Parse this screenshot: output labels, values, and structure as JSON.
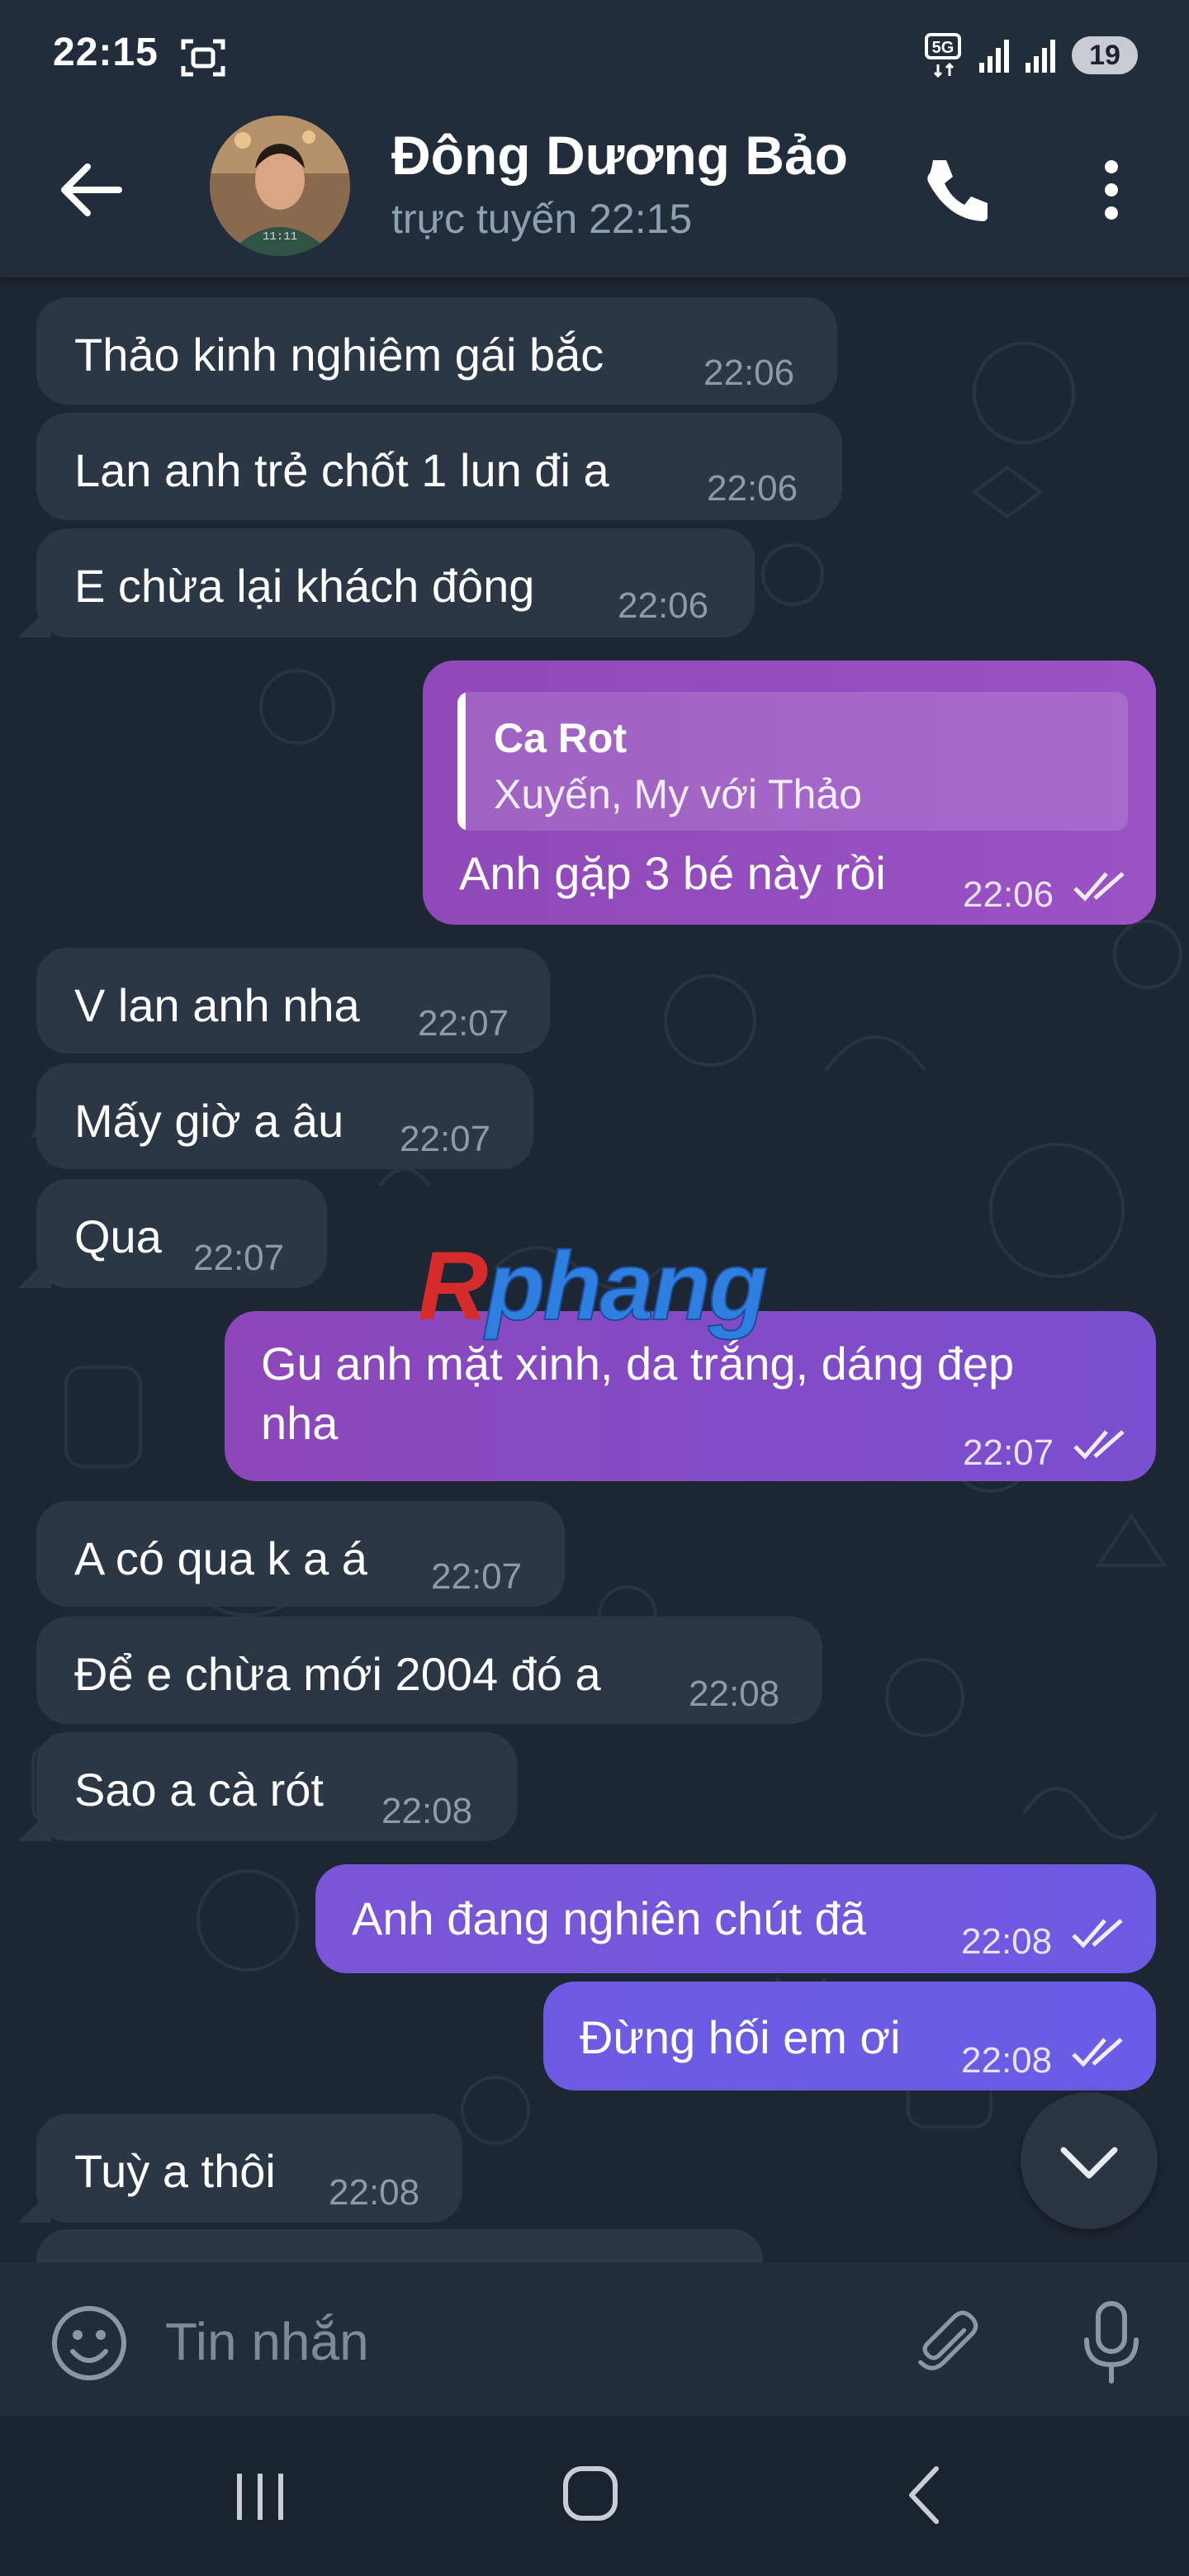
{
  "status_bar": {
    "time": "22:15",
    "battery": "19",
    "network": "5G",
    "icons": [
      "screenshot-icon",
      "5g-icon",
      "signal-icon",
      "signal-icon-2",
      "battery-icon"
    ]
  },
  "header": {
    "contact_name": "Đông Dương Bảo",
    "status": "trực tuyến 22:15",
    "icons": [
      "back-arrow-icon",
      "avatar",
      "phone-icon",
      "more-vertical-icon"
    ]
  },
  "messages": [
    {
      "dir": "in",
      "text": "Thảo kinh nghiêm gái bắc",
      "time": "22:06"
    },
    {
      "dir": "in",
      "text": "Lan anh trẻ chốt 1 lun đi a",
      "time": "22:06"
    },
    {
      "dir": "in",
      "text": "E chừa lại khách đông",
      "time": "22:06"
    },
    {
      "dir": "out",
      "reply_to": {
        "name": "Ca Rot",
        "text": "Xuyến, My với Thảo"
      },
      "text": "Anh gặp 3 bé này rồi",
      "time": "22:06",
      "read": true
    },
    {
      "dir": "in",
      "text": "V lan anh nha",
      "time": "22:07"
    },
    {
      "dir": "in",
      "text": "Mấy giờ a âu",
      "time": "22:07"
    },
    {
      "dir": "in",
      "text": "Qua",
      "time": "22:07"
    },
    {
      "dir": "out",
      "text_line1": "Gu anh mặt xinh, da trắng, dáng đẹp",
      "text_line2": "nha",
      "time": "22:07",
      "read": true
    },
    {
      "dir": "in",
      "text": "A có qua k a á",
      "time": "22:07"
    },
    {
      "dir": "in",
      "text": "Để e chừa mới 2004 đó a",
      "time": "22:08"
    },
    {
      "dir": "in",
      "text": "Sao a cà rót",
      "time": "22:08"
    },
    {
      "dir": "out",
      "text": "Anh đang nghiên chút đã",
      "time": "22:08",
      "read": true
    },
    {
      "dir": "out",
      "text": "Đừng hối em ơi",
      "time": "22:08",
      "read": true
    },
    {
      "dir": "in",
      "text": "Tuỳ a thôi",
      "time": "22:08"
    }
  ],
  "watermark": {
    "first": "R",
    "rest": "phang"
  },
  "input": {
    "placeholder": "Tin nhắn"
  },
  "colors": {
    "header_bg": "#212d3b",
    "chat_bg": "#1d2733",
    "incoming_bubble": "#2b3744",
    "outgoing_gradient": [
      "#9d4fbf",
      "#6b5ce8"
    ],
    "secondary_text": "#8d9aa8"
  },
  "navigation": {
    "icons": [
      "recent-apps-icon",
      "home-icon",
      "back-nav-icon"
    ]
  }
}
